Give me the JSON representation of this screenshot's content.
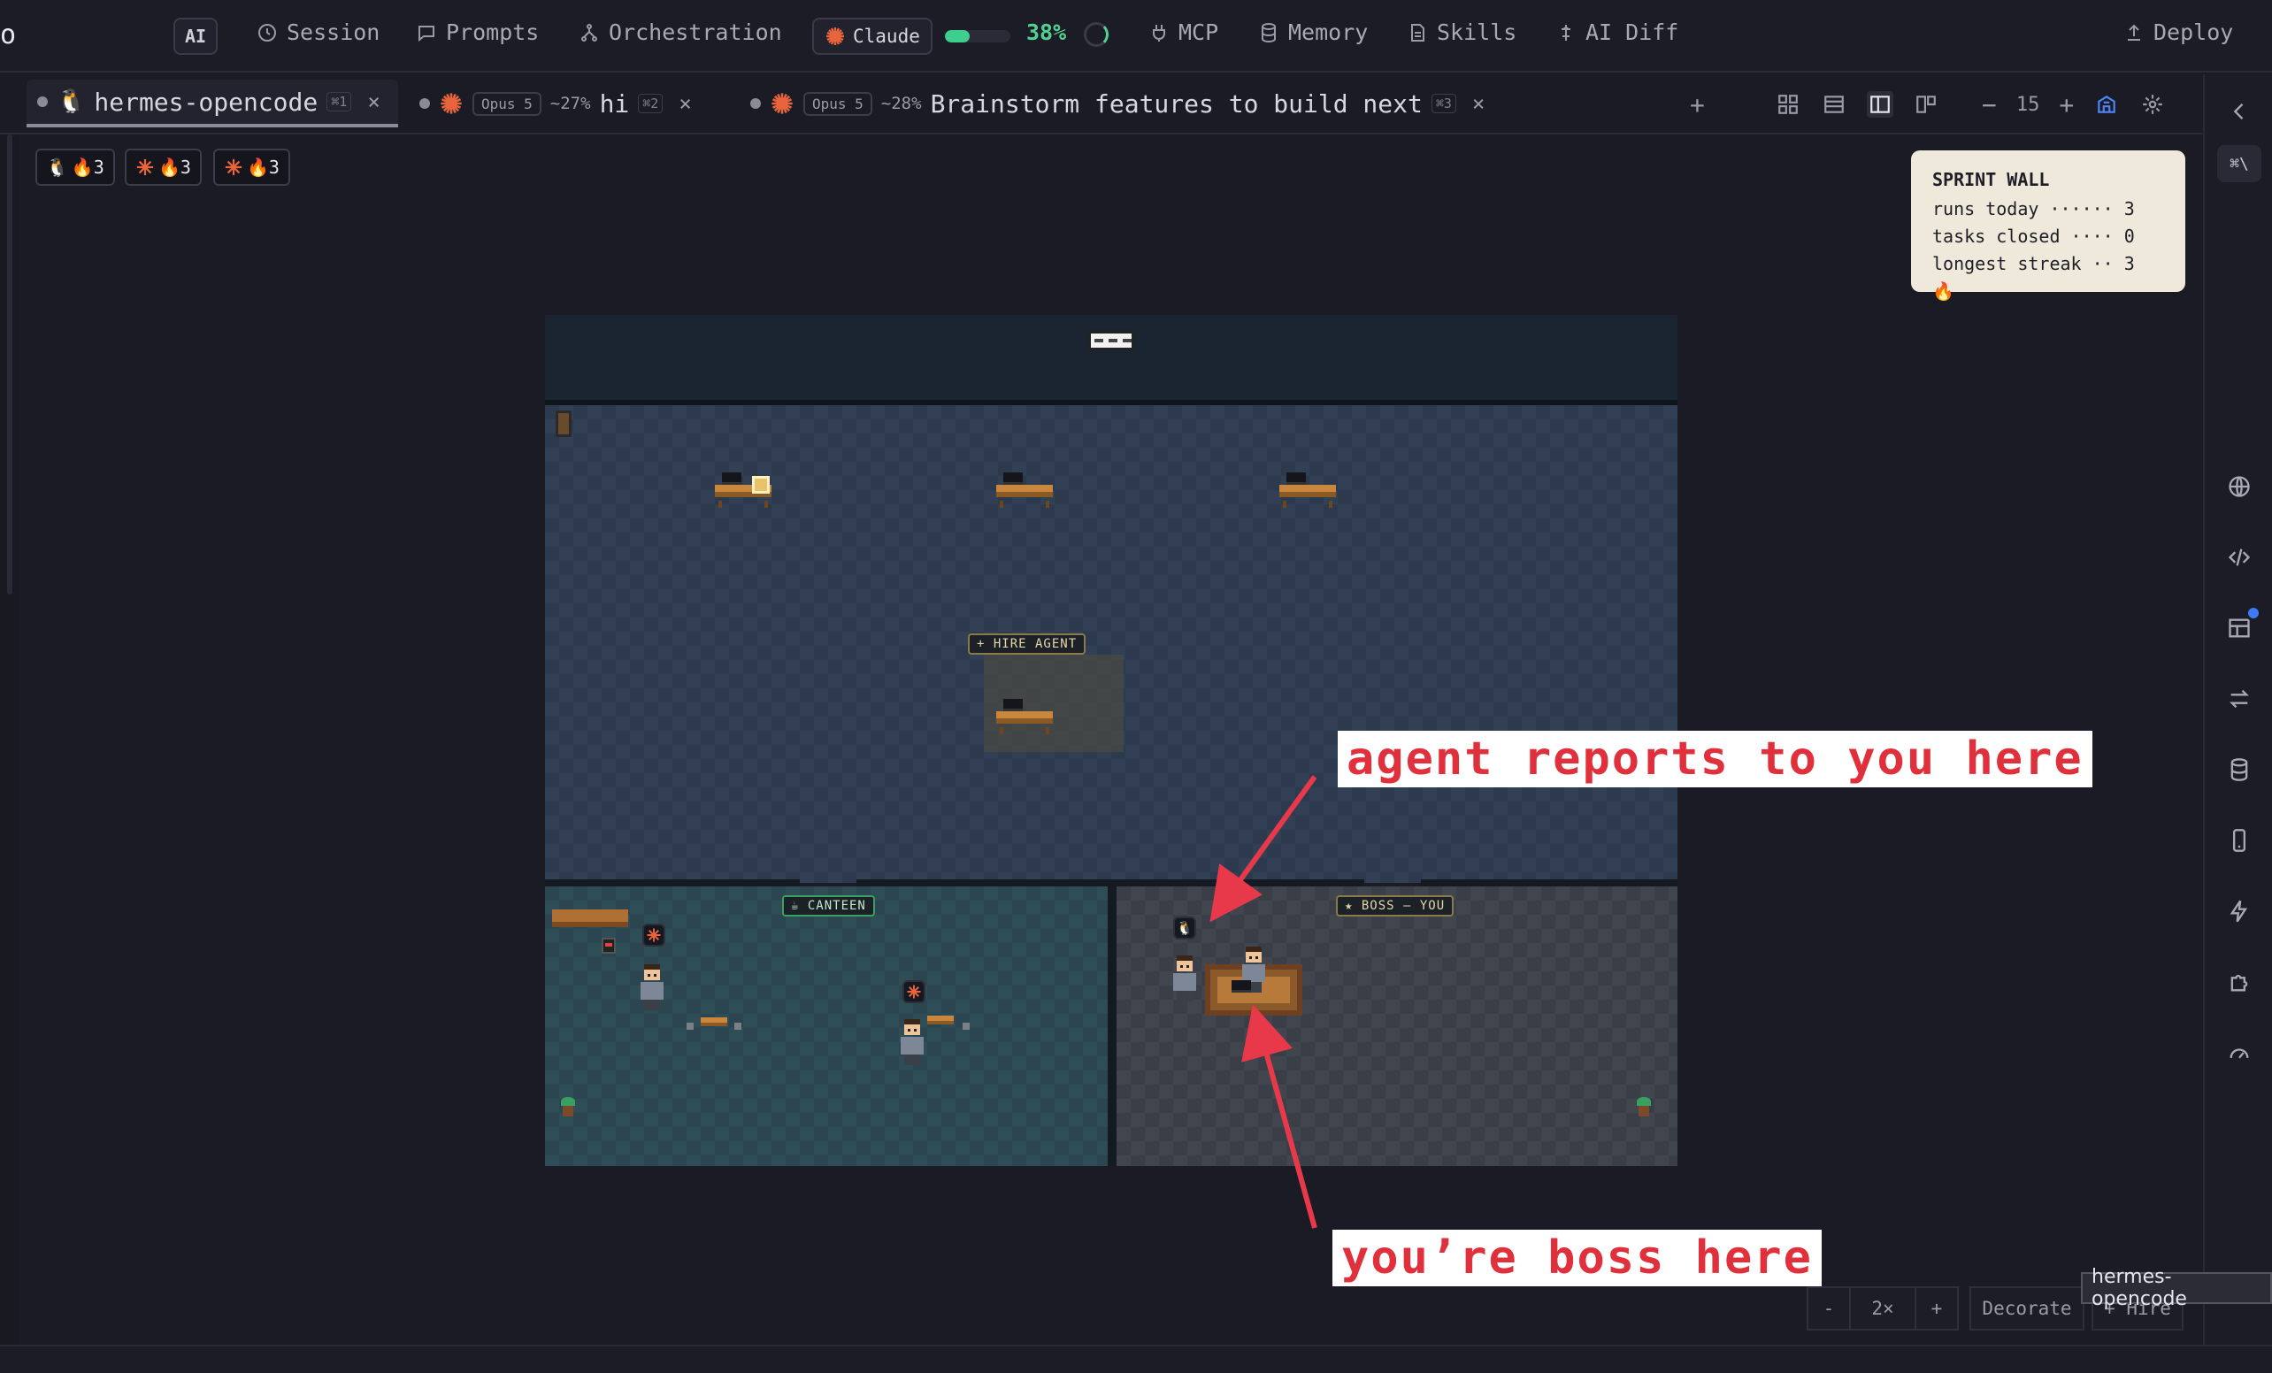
{
  "app": {
    "brand_fragment": "o",
    "ai_badge": "AI"
  },
  "nav": {
    "session": "Session",
    "prompts": "Prompts",
    "orchestration": "Orchestration",
    "claude": "Claude",
    "usage_pct": "38%",
    "usage_fraction": 0.38,
    "mcp": "MCP",
    "memory": "Memory",
    "skills": "Skills",
    "ai_diff": "AI Diff",
    "deploy": "Deploy"
  },
  "tabs": [
    {
      "title": "hermes-opencode",
      "kbd": "⌘1",
      "active": true
    },
    {
      "title": "hi",
      "model": "Opus 5",
      "pct": "~27%",
      "kbd": "⌘2"
    },
    {
      "title": "Brainstorm features to build next",
      "model": "Opus 5",
      "pct": "~28%",
      "kbd": "⌘3"
    }
  ],
  "toolbar": {
    "zoom_value": "15",
    "add": "+",
    "minus": "−",
    "plus": "+"
  },
  "rail": {
    "shortcut": "⌘\\"
  },
  "streaks": [
    {
      "icon": "hermes-icon",
      "count": "🔥3"
    },
    {
      "icon": "claude-icon",
      "count": "🔥3"
    },
    {
      "icon": "claude-icon",
      "count": "🔥3"
    }
  ],
  "sprint_wall": {
    "title": "SPRINT WALL",
    "lines": [
      "runs today ······ 3",
      "tasks closed ···· 0",
      "longest streak ·· 3 🔥"
    ]
  },
  "office": {
    "hire_label": "+ HIRE AGENT",
    "canteen_label": "☕ CANTEEN",
    "boss_label": "★ BOSS — YOU"
  },
  "annotations": {
    "reports": "agent reports to you here",
    "boss": "you’re boss here"
  },
  "bottom": {
    "zoom_minus": "-",
    "zoom_level": "2×",
    "zoom_plus": "+",
    "decorate": "Decorate",
    "hire": "+ Hire",
    "tooltip": "hermes-opencode"
  },
  "colors": {
    "accent_green": "#4fd18f",
    "claude_orange": "#e8643c",
    "annotation_red": "#e0303c"
  }
}
